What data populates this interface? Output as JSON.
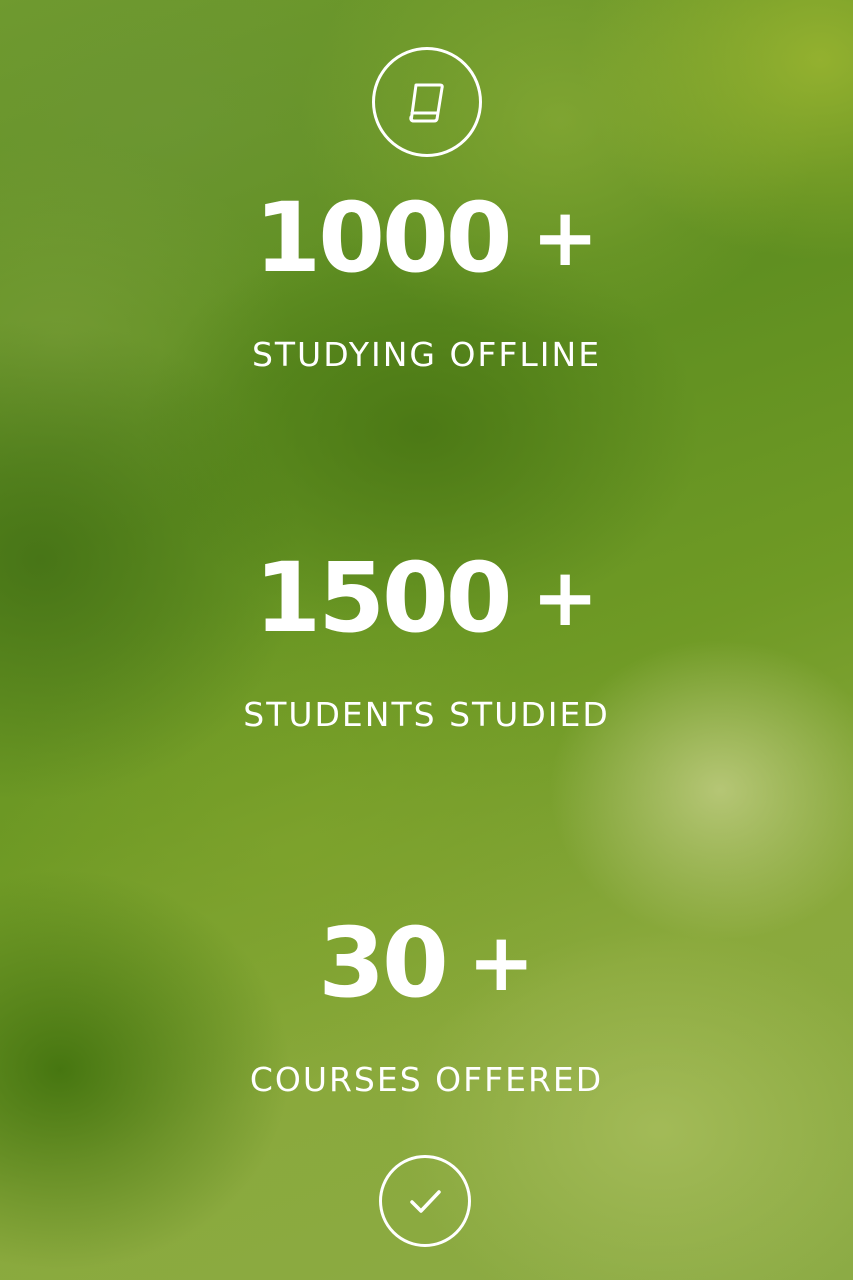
{
  "icons": {
    "top": "book-icon",
    "bottom": "check-icon"
  },
  "stats": [
    {
      "number": "1000",
      "suffix": "+",
      "label": "STUDYING OFFLINE"
    },
    {
      "number": "1500",
      "suffix": "+",
      "label": "STUDENTS STUDIED"
    },
    {
      "number": "30",
      "suffix": "+",
      "label": "COURSES OFFERED"
    }
  ],
  "colors": {
    "text": "#ffffff",
    "background": "#6f9a2e"
  }
}
